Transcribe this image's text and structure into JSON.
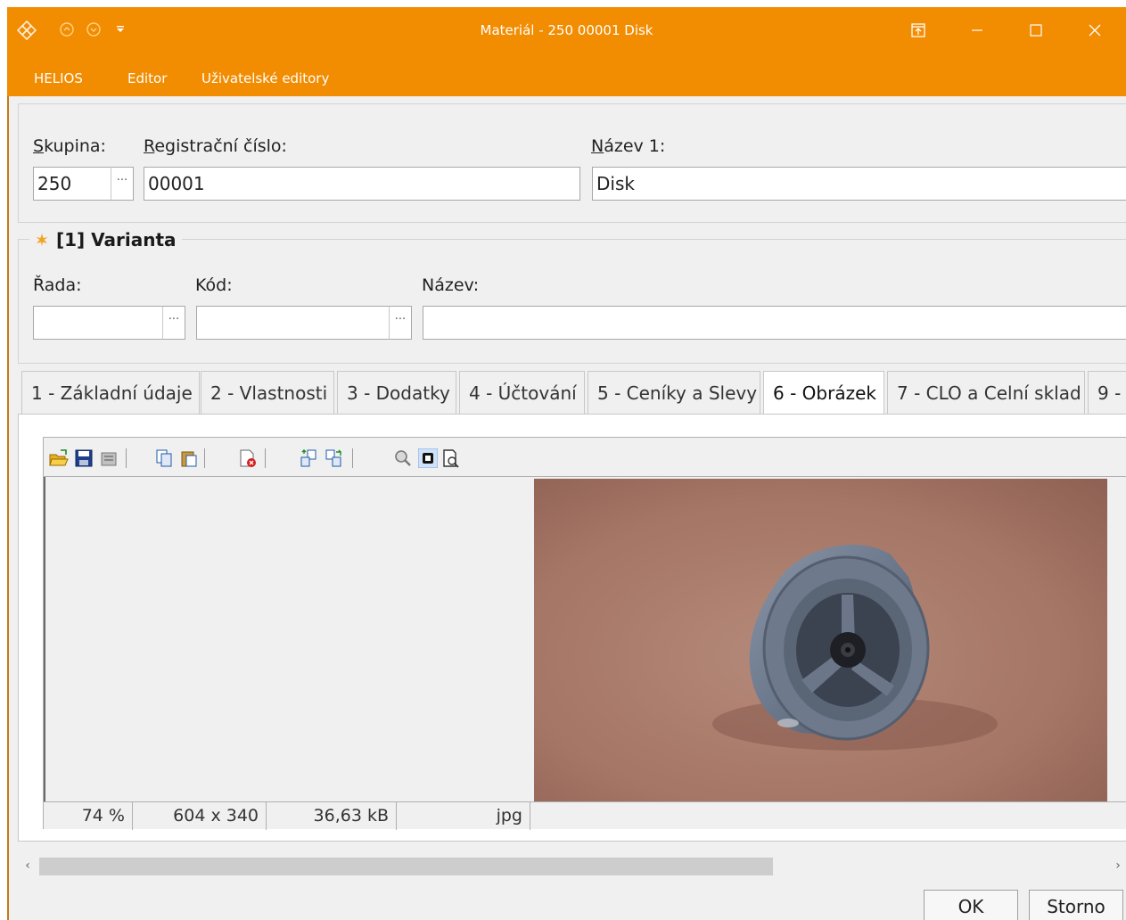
{
  "window": {
    "title": "Materiál - 250 00001 Disk",
    "accent_color": "#f28c00",
    "app_icon": "helios-logo-icon",
    "quick_access": [
      "back-circle-icon",
      "forward-circle-icon",
      "dropdown-arrow-icon"
    ],
    "controls": [
      "pin-window-icon",
      "minimize-icon",
      "maximize-icon",
      "close-icon"
    ]
  },
  "menu": {
    "items": [
      "HELIOS",
      "Editor",
      "Uživatelské editory"
    ]
  },
  "header": {
    "group_label_prefix": "S",
    "group_label_rest": "kupina:",
    "group_value": "250",
    "reg_label_prefix": "R",
    "reg_label_rest": "egistrační číslo:",
    "reg_value": "00001",
    "name_label_prefix": "N",
    "name_label_rest": "ázev 1:",
    "name_value": "Disk",
    "lookup_glyph": "···"
  },
  "variant": {
    "legend": "[1] Varianta",
    "legend_icon": "star-asterisk-icon",
    "row_label": "Řada:",
    "code_label": "Kód:",
    "name_label": "Název:",
    "row_value": "",
    "code_value": "",
    "name_value": ""
  },
  "tabs": [
    "1 - Základní údaje",
    "2 - Vlastnosti",
    "3 - Dodatky",
    "4 - Účtování",
    "5 - Ceníky a Slevy",
    "6 - Obrázek",
    "7 - CLO a Celní sklad",
    "9 -"
  ],
  "active_tab": "6 - Obrázek",
  "image_toolbar": [
    "open-folder-icon",
    "save-icon",
    "scan-icon",
    "copy-icon",
    "paste-icon",
    "delete-image-icon",
    "export-icon",
    "import-icon",
    "zoom-icon",
    "fit-view-icon",
    "preview-icon"
  ],
  "image_status": {
    "zoom": "74 %",
    "dimensions": "604 x 340",
    "size": "36,63 kB",
    "format": "jpg"
  },
  "buttons": {
    "ok": "OK",
    "cancel": "Storno"
  }
}
